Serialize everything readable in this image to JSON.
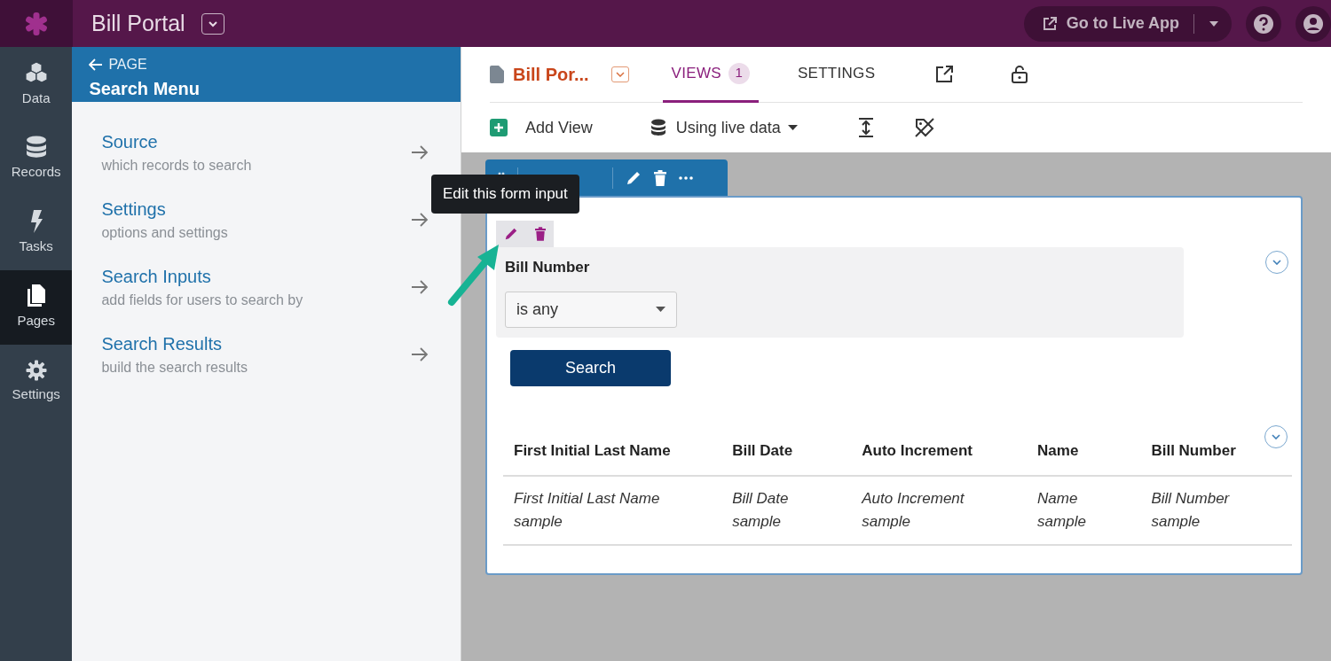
{
  "app": {
    "title": "Bill Portal",
    "live_app_button": "Go to Live App"
  },
  "rail": [
    {
      "label": "Data",
      "selected": false
    },
    {
      "label": "Records",
      "selected": false
    },
    {
      "label": "Tasks",
      "selected": false
    },
    {
      "label": "Pages",
      "selected": true
    },
    {
      "label": "Settings",
      "selected": false
    }
  ],
  "panel": {
    "back": "PAGE",
    "title": "Search Menu",
    "items": [
      {
        "title": "Source",
        "description": "which records to search"
      },
      {
        "title": "Settings",
        "description": "options and settings"
      },
      {
        "title": "Search Inputs",
        "description": "add fields for users to search by"
      },
      {
        "title": "Search Results",
        "description": "build the search results"
      }
    ]
  },
  "page_header": {
    "page_name": "Bill Por...",
    "tabs": [
      {
        "label": "VIEWS",
        "count": "1",
        "selected": true
      },
      {
        "label": "SETTINGS",
        "selected": false
      }
    ]
  },
  "toolbar": {
    "add_view": "Add View",
    "data_mode": "Using live data"
  },
  "tooltip": "Edit this form input",
  "filter": {
    "label": "Bill Number",
    "value": "is any"
  },
  "search_button": "Search",
  "table": {
    "columns": [
      "First Initial Last Name",
      "Bill Date",
      "Auto Increment",
      "Name",
      "Bill Number"
    ],
    "rows": [
      [
        "First Initial Last Name sample",
        "Bill Date sample",
        "Auto Increment sample",
        "Name sample",
        "Bill Number sample"
      ]
    ]
  }
}
